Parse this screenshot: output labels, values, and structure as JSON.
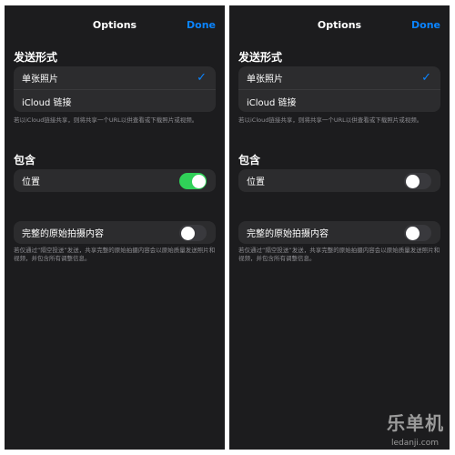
{
  "screens": [
    {
      "nav": {
        "title": "Options",
        "done_label": "Done"
      },
      "send_section": {
        "header": "发送形式",
        "options": [
          {
            "label": "单张照片",
            "selected": true,
            "check_icon": "checkmark-icon"
          },
          {
            "label": "iCloud 链接",
            "selected": false
          }
        ],
        "footnote": "若以iCloud链接共享，则将共享一个URL以供查看或下载照片或视频。"
      },
      "include_section": {
        "header": "包含",
        "location_label": "位置",
        "location_on": true
      },
      "original_row": {
        "label": "完整的原始拍摄内容",
        "on": false,
        "footnote": "若仅通过“隔空投送”发送，共享完整的原始拍摄内容会以原始质量发送照片和视频，并包含所有调整信息。"
      }
    },
    {
      "nav": {
        "title": "Options",
        "done_label": "Done"
      },
      "send_section": {
        "header": "发送形式",
        "options": [
          {
            "label": "单张照片",
            "selected": true,
            "check_icon": "checkmark-icon"
          },
          {
            "label": "iCloud 链接",
            "selected": false
          }
        ],
        "footnote": "若以iCloud链接共享，则将共享一个URL以供查看或下载照片或视频。"
      },
      "include_section": {
        "header": "包含",
        "location_label": "位置",
        "location_on": false
      },
      "original_row": {
        "label": "完整的原始拍摄内容",
        "on": false,
        "footnote": "若仅通过“隔空投送”发送，共享完整的原始拍摄内容会以原始质量发送照片和视频，并包含所有调整信息。"
      }
    }
  ],
  "watermark": {
    "text": "乐单机",
    "url": "ledanji.com"
  },
  "colors": {
    "background": "#1c1c1e",
    "cell": "#2c2c2e",
    "accent": "#0a84ff",
    "toggle_on": "#30d158",
    "toggle_off": "#39393d",
    "secondary_text": "#8e8e93"
  }
}
